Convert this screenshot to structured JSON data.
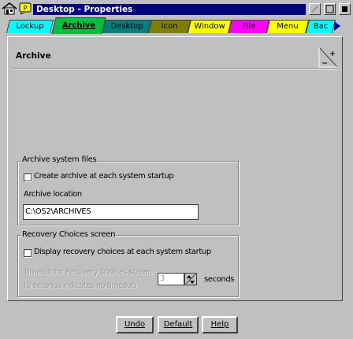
{
  "window": {
    "title": "Desktop - Properties"
  },
  "tabs": [
    {
      "label": "Lockup",
      "color": "#00ffff"
    },
    {
      "label": "Archive",
      "color": "#00c040",
      "active": true
    },
    {
      "label": "Desktop",
      "color": "#008080"
    },
    {
      "label": "Icon",
      "color": "#808000"
    },
    {
      "label": "Window",
      "color": "#ffff00"
    },
    {
      "label": "File",
      "color": "#ff00ff"
    },
    {
      "label": "Menu",
      "color": "#ffff00"
    },
    {
      "label": "Bac",
      "color": "#00ffff"
    }
  ],
  "page": {
    "title": "Archive"
  },
  "archive_group": {
    "label": "Archive system files",
    "checkbox_label": "Create archive at each system startup",
    "location_label": "Archive location",
    "location_value": "C:\\OS2\\ARCHIVES"
  },
  "recovery_group": {
    "label": "Recovery Choices screen",
    "checkbox_label": "Display recovery choices at each system startup",
    "timeout_label_1": "Timeout for Recovery Choices screen",
    "timeout_label_2": "(0 seconds indicates no timeout)",
    "timeout_value": "3",
    "seconds_label": "seconds"
  },
  "buttons": {
    "undo": "Undo",
    "default": "Default",
    "help": "Help"
  }
}
